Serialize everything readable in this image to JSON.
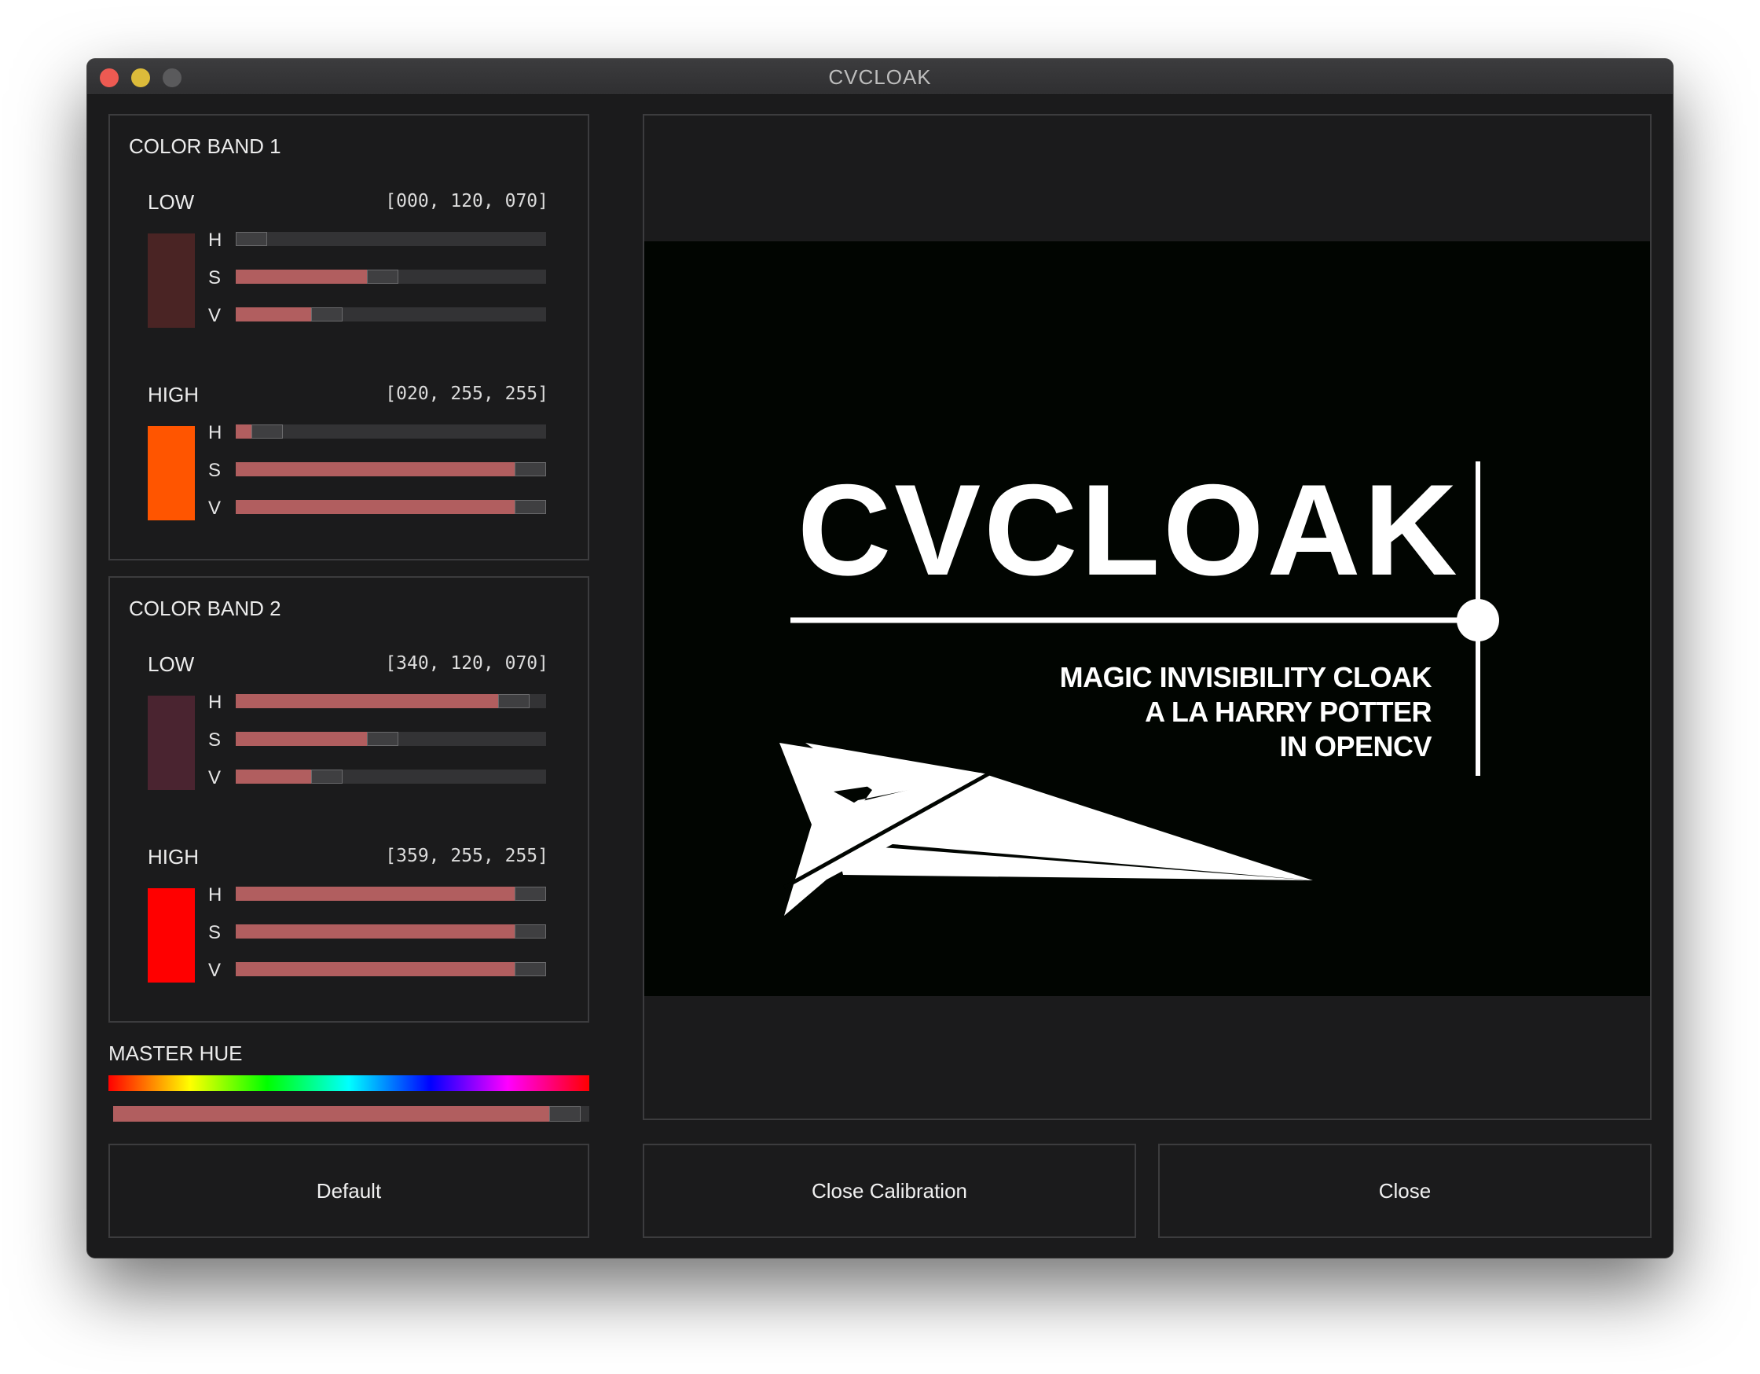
{
  "window": {
    "title": "CVCLOAK"
  },
  "band1": {
    "title": "COLOR BAND 1",
    "low": {
      "label": "LOW",
      "value": "[000, 120, 070]",
      "swatch": "#4a2424",
      "channels": [
        {
          "label": "H",
          "level": 0.0
        },
        {
          "label": "S",
          "level": 0.47
        },
        {
          "label": "V",
          "level": 0.27
        }
      ]
    },
    "high": {
      "label": "HIGH",
      "value": "[020, 255, 255]",
      "swatch": "#ff5500",
      "channels": [
        {
          "label": "H",
          "level": 0.056
        },
        {
          "label": "S",
          "level": 1.0
        },
        {
          "label": "V",
          "level": 1.0
        }
      ]
    }
  },
  "band2": {
    "title": "COLOR BAND 2",
    "low": {
      "label": "LOW",
      "value": "[340, 120, 070]",
      "swatch": "#4a2430",
      "channels": [
        {
          "label": "H",
          "level": 0.94
        },
        {
          "label": "S",
          "level": 0.47
        },
        {
          "label": "V",
          "level": 0.27
        }
      ]
    },
    "high": {
      "label": "HIGH",
      "value": "[359, 255, 255]",
      "swatch": "#ff0000",
      "channels": [
        {
          "label": "H",
          "level": 1.0
        },
        {
          "label": "S",
          "level": 1.0
        },
        {
          "label": "V",
          "level": 1.0
        }
      ]
    }
  },
  "master_hue": {
    "label": "MASTER HUE",
    "level": 0.98
  },
  "preview": {
    "logo": "CVCLOAK",
    "tagline": [
      "MAGIC INVISIBILITY CLOAK",
      "A LA HARRY POTTER",
      "IN OPENCV"
    ]
  },
  "buttons": {
    "default": "Default",
    "close_calibration": "Close Calibration",
    "close": "Close"
  },
  "colors": {
    "slider_fill": "#b15e5f",
    "background": "#1b1b1c",
    "border": "#3c3c3e"
  }
}
